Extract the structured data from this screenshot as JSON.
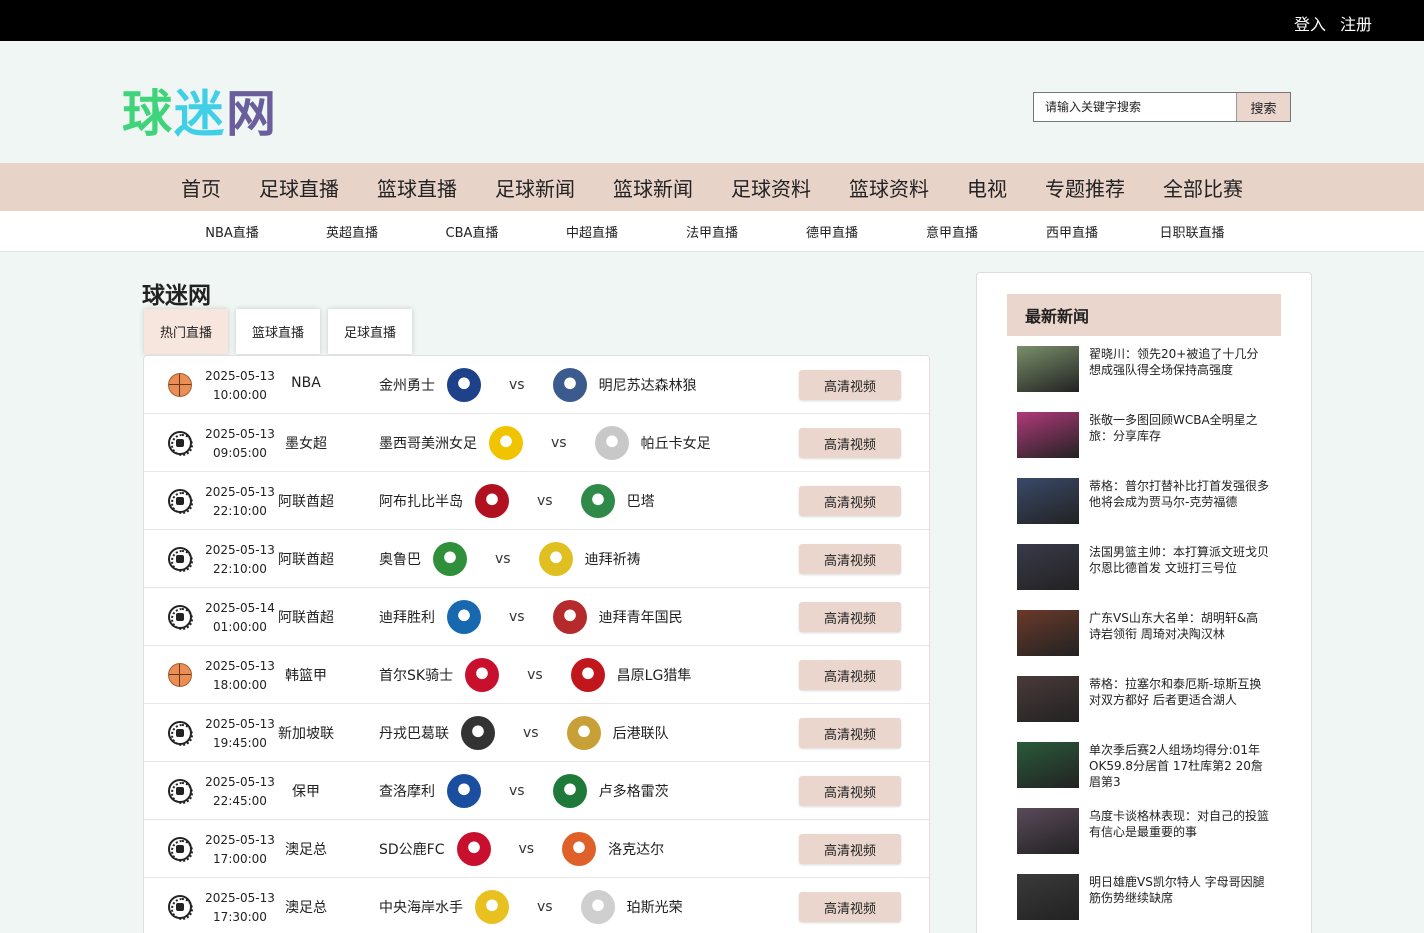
{
  "auth": {
    "login": "登入",
    "register": "注册"
  },
  "logo": {
    "part1": "球",
    "part2": "迷",
    "part3": "网"
  },
  "search": {
    "placeholder": "请输入关键字搜索",
    "button": "搜索"
  },
  "main_nav": [
    "首页",
    "足球直播",
    "篮球直播",
    "足球新闻",
    "篮球新闻",
    "足球资料",
    "篮球资料",
    "电视",
    "专题推荐",
    "全部比赛"
  ],
  "sub_nav": [
    "NBA直播",
    "英超直播",
    "CBA直播",
    "中超直播",
    "法甲直播",
    "德甲直播",
    "意甲直播",
    "西甲直播",
    "日职联直播"
  ],
  "section_title": "球迷网",
  "tabs": [
    "热门直播",
    "篮球直播",
    "足球直播"
  ],
  "matches": [
    {
      "sport": "basketball-icon",
      "date": "2025-05-13",
      "time": "10:00:00",
      "league": "NBA",
      "home": "金州勇士",
      "vs": "vs",
      "away": "明尼苏达森林狼",
      "button": "高清视频"
    },
    {
      "sport": "soccer-icon",
      "date": "2025-05-13",
      "time": "09:05:00",
      "league": "墨女超",
      "home": "墨西哥美洲女足",
      "vs": "vs",
      "away": "帕丘卡女足",
      "button": "高清视频"
    },
    {
      "sport": "soccer-icon",
      "date": "2025-05-13",
      "time": "22:10:00",
      "league": "阿联酋超",
      "home": "阿布扎比半岛",
      "vs": "vs",
      "away": "巴塔",
      "button": "高清视频"
    },
    {
      "sport": "soccer-icon",
      "date": "2025-05-13",
      "time": "22:10:00",
      "league": "阿联酋超",
      "home": "奥鲁巴",
      "vs": "vs",
      "away": "迪拜祈祷",
      "button": "高清视频"
    },
    {
      "sport": "soccer-icon",
      "date": "2025-05-14",
      "time": "01:00:00",
      "league": "阿联酋超",
      "home": "迪拜胜利",
      "vs": "vs",
      "away": "迪拜青年国民",
      "button": "高清视频"
    },
    {
      "sport": "basketball-icon",
      "date": "2025-05-13",
      "time": "18:00:00",
      "league": "韩篮甲",
      "home": "首尔SK骑士",
      "vs": "vs",
      "away": "昌原LG猎隼",
      "button": "高清视频"
    },
    {
      "sport": "soccer-icon",
      "date": "2025-05-13",
      "time": "19:45:00",
      "league": "新加坡联",
      "home": "丹戎巴葛联",
      "vs": "vs",
      "away": "后港联队",
      "button": "高清视频"
    },
    {
      "sport": "soccer-icon",
      "date": "2025-05-13",
      "time": "22:45:00",
      "league": "保甲",
      "home": "查洛摩利",
      "vs": "vs",
      "away": "卢多格雷茨",
      "button": "高清视频"
    },
    {
      "sport": "soccer-icon",
      "date": "2025-05-13",
      "time": "17:00:00",
      "league": "澳足总",
      "home": "SD公鹿FC",
      "vs": "vs",
      "away": "洛克达尔",
      "button": "高清视频"
    },
    {
      "sport": "soccer-icon",
      "date": "2025-05-13",
      "time": "17:30:00",
      "league": "澳足总",
      "home": "中央海岸水手",
      "vs": "vs",
      "away": "珀斯光荣",
      "button": "高清视频"
    }
  ],
  "badge_colors": [
    [
      "#1d428a",
      "#3b5b8f"
    ],
    [
      "#f0c400",
      "#c8c8c8"
    ],
    [
      "#b01020",
      "#2f8a4a"
    ],
    [
      "#2f8f3a",
      "#e0c020"
    ],
    [
      "#1868b0",
      "#b52a2a"
    ],
    [
      "#c8102e",
      "#c0161c"
    ],
    [
      "#333333",
      "#c8a038"
    ],
    [
      "#1a4fa0",
      "#1f7a3a"
    ],
    [
      "#c8102e",
      "#e0602a"
    ],
    [
      "#e8c020",
      "#cfcfcf"
    ]
  ],
  "sidebar": {
    "title": "最新新闻",
    "news": [
      {
        "text": "翟晓川：领先20+被追了十几分 想成强队得全场保持高强度",
        "color": "#7a8f6a"
      },
      {
        "text": "张敬一多图回顾WCBA全明星之旅：分享库存",
        "color": "#b03a7a"
      },
      {
        "text": "蒂格：普尔打替补比打首发强很多 他将会成为贾马尔-克劳福德",
        "color": "#3a4a6a"
      },
      {
        "text": "法国男篮主帅：本打算派文班戈贝尔恩比德首发 文班打三号位",
        "color": "#3a3a4a"
      },
      {
        "text": "广东VS山东大名单：胡明轩&高诗岩领衔 周琦对决陶汉林",
        "color": "#6a3a2a"
      },
      {
        "text": "蒂格：拉塞尔和泰厄斯-琼斯互换对双方都好 后者更适合湖人",
        "color": "#4a3a3a"
      },
      {
        "text": "单次季后赛2人组场均得分:01年OK59.8分居首 17杜库第2 20詹眉第3",
        "color": "#2a5a3a"
      },
      {
        "text": "乌度卡谈格林表现：对自己的投篮有信心是最重要的事",
        "color": "#5a4a5a"
      },
      {
        "text": "明日雄鹿VS凯尔特人 字母哥因腿筋伤势继续缺席",
        "color": "#3a3a3a"
      }
    ]
  }
}
